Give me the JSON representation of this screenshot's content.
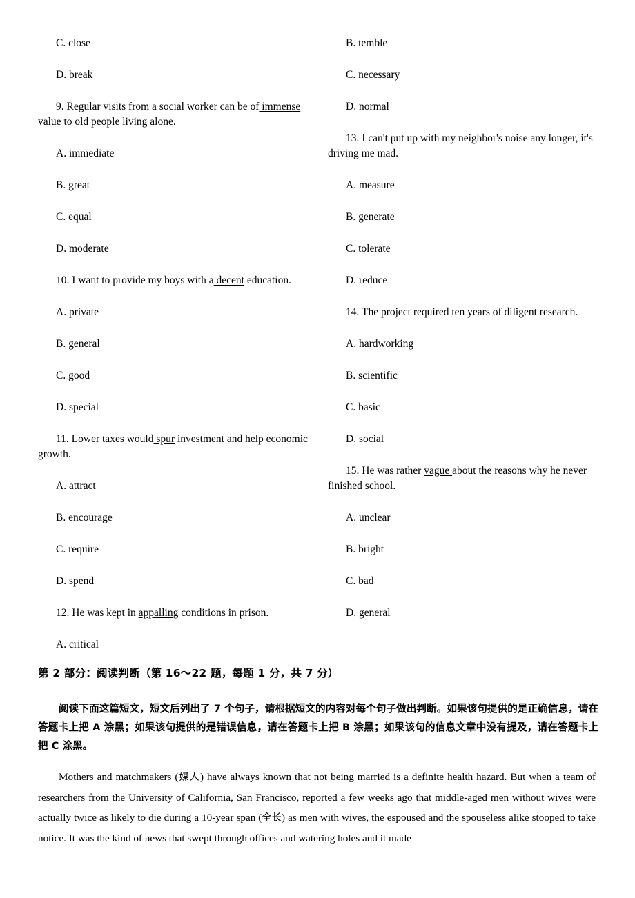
{
  "document": {
    "type": "exam-paper-page",
    "language": "en-zh"
  },
  "left_column": {
    "items": [
      {
        "kind": "option",
        "text": "C. close"
      },
      {
        "kind": "option",
        "text": "D. break"
      },
      {
        "kind": "stem",
        "number": "9.",
        "pre": "9. Regular visits from a social worker can be of",
        "underlined": " immense",
        "post": " value to old people living alone."
      },
      {
        "kind": "option",
        "text": "A. immediate"
      },
      {
        "kind": "option",
        "text": "B. great"
      },
      {
        "kind": "option",
        "text": "C. equal"
      },
      {
        "kind": "option",
        "text": "D. moderate"
      },
      {
        "kind": "stem",
        "number": "10.",
        "pre": "10. I want to provide my boys with a",
        "underlined": " decent",
        "post": " education."
      },
      {
        "kind": "option",
        "text": "A. private"
      },
      {
        "kind": "option",
        "text": "B. general"
      },
      {
        "kind": "option",
        "text": "C. good"
      },
      {
        "kind": "option",
        "text": "D. special"
      },
      {
        "kind": "stem",
        "number": "11.",
        "pre": "11. Lower taxes would",
        "underlined": " spur",
        "post": " investment and help economic growth."
      },
      {
        "kind": "option",
        "text": "A. attract"
      },
      {
        "kind": "option",
        "text": "B. encourage"
      },
      {
        "kind": "option",
        "text": "C. require"
      },
      {
        "kind": "option",
        "text": "D. spend"
      },
      {
        "kind": "stem",
        "number": "12.",
        "pre": "12. He was kept in ",
        "underlined": "appalling",
        "post": " conditions in prison."
      },
      {
        "kind": "option",
        "text": "A. critical"
      }
    ]
  },
  "right_column": {
    "items": [
      {
        "kind": "option",
        "text": "B. temble"
      },
      {
        "kind": "option",
        "text": "C. necessary"
      },
      {
        "kind": "option",
        "text": "D. normal"
      },
      {
        "kind": "stem",
        "number": "13.",
        "pre": "13. I can't ",
        "underlined": "put up with",
        "post": " my neighbor's noise any longer, it's driving me mad."
      },
      {
        "kind": "option",
        "text": "A. measure"
      },
      {
        "kind": "option",
        "text": "B. generate"
      },
      {
        "kind": "option",
        "text": "C. tolerate"
      },
      {
        "kind": "option",
        "text": "D. reduce"
      },
      {
        "kind": "stem",
        "number": "14.",
        "pre": "14. The project required ten years of ",
        "underlined": "diligent ",
        "post": "research."
      },
      {
        "kind": "option",
        "text": "A. hardworking"
      },
      {
        "kind": "option",
        "text": "B. scientific"
      },
      {
        "kind": "option",
        "text": "C. basic"
      },
      {
        "kind": "option",
        "text": "D. social"
      },
      {
        "kind": "stem",
        "number": "15.",
        "pre": "15. He was rather ",
        "underlined": "vague ",
        "post": "about the reasons why he never finished school."
      },
      {
        "kind": "option",
        "text": "A. unclear"
      },
      {
        "kind": "option",
        "text": "B. bright"
      },
      {
        "kind": "option",
        "text": "C. bad"
      },
      {
        "kind": "option",
        "text": "D. general"
      }
    ]
  },
  "section": {
    "heading": "第 2 部分：阅读判断（第 16～22 题，每题 1 分，共 7 分）",
    "instruction": "阅读下面这篇短文，短文后列出了 7 个句子，请根据短文的内容对每个句子做出判断。如果该句提供的是正确信息，请在答题卡上把 A 涂黑；如果该句提供的是错误信息，请在答题卡上把 B 涂黑；如果该句的信息文章中没有提及，请在答题卡上把 C 涂黑。"
  },
  "passage": {
    "part1": "Mothers and matchmakers (",
    "gloss1": "媒人",
    "part2": ") have always known that not being married is a definite health hazard. But when a team of researchers from the University of California, San Francisco, reported a few weeks ago that middle-aged men without wives were actually twice as likely to die during a 10-year span (",
    "gloss2": "全长",
    "part3": ") as men with wives, the espoused and the spouseless alike stooped to take notice. It was the kind of news that swept through offices and watering holes and it made"
  }
}
